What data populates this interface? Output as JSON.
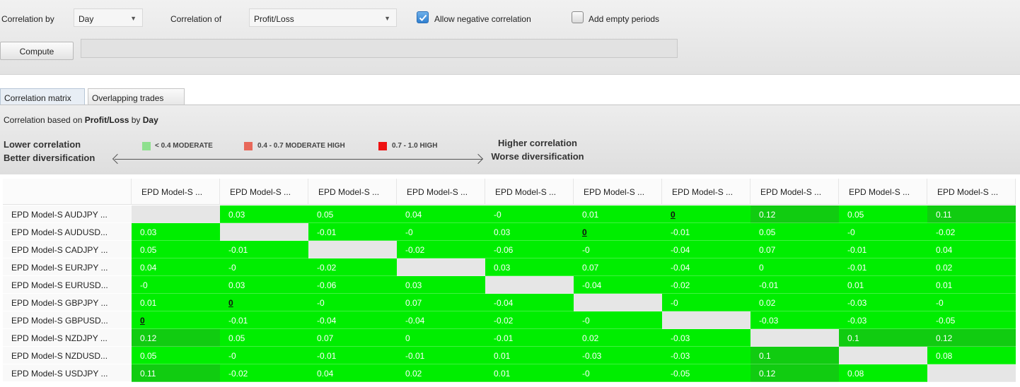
{
  "toolbar": {
    "correlation_by_label": "Correlation by",
    "correlation_by_value": "Day",
    "correlation_of_label": "Correlation of",
    "correlation_of_value": "Profit/Loss",
    "allow_negative_label": "Allow negative correlation",
    "allow_negative_checked": true,
    "add_empty_label": "Add empty periods",
    "add_empty_checked": false,
    "compute_label": "Compute"
  },
  "tabs": [
    {
      "label": "Correlation matrix",
      "active": true
    },
    {
      "label": "Overlapping trades",
      "active": false
    }
  ],
  "info": {
    "prefix": "Correlation based on ",
    "metric": "Profit/Loss",
    "middle": " by ",
    "period": "Day"
  },
  "legend": {
    "lower_line1": "Lower correlation",
    "lower_line2": "Better diversification",
    "higher_line1": "Higher correlation",
    "higher_line2": "Worse diversification",
    "items": [
      {
        "label": "< 0.4 MODERATE",
        "color": "#8ee08e"
      },
      {
        "label": "0.4 - 0.7 MODERATE HIGH",
        "color": "#e8685a"
      },
      {
        "label": "0.7 - 1.0 HIGH",
        "color": "#ee1111"
      }
    ]
  },
  "colors": {
    "low_green": "#00ee00",
    "mid_green": "#11cc11",
    "diagonal": "#e6e6e6"
  },
  "matrix": {
    "col_headers": [
      "EPD Model-S ...",
      "EPD Model-S ...",
      "EPD Model-S ...",
      "EPD Model-S ...",
      "EPD Model-S ...",
      "EPD Model-S ...",
      "EPD Model-S ...",
      "EPD Model-S ...",
      "EPD Model-S ...",
      "EPD Model-S ..."
    ],
    "row_labels": [
      "EPD Model-S AUDJPY ...",
      "EPD Model-S AUDUSD...",
      "EPD Model-S CADJPY ...",
      "EPD Model-S EURJPY ...",
      "EPD Model-S EURUSD...",
      "EPD Model-S GBPJPY ...",
      "EPD Model-S GBPUSD...",
      "EPD Model-S NZDJPY ...",
      "EPD Model-S NZDUSD...",
      "EPD Model-S USDJPY ..."
    ],
    "values": [
      [
        "",
        "0.03",
        "0.05",
        "0.04",
        "-0",
        "0.01",
        "0",
        "0.12",
        "0.05",
        "0.11"
      ],
      [
        "0.03",
        "",
        "-0.01",
        "-0",
        "0.03",
        "0",
        "-0.01",
        "0.05",
        "-0",
        "-0.02"
      ],
      [
        "0.05",
        "-0.01",
        "",
        "-0.02",
        "-0.06",
        "-0",
        "-0.04",
        "0.07",
        "-0.01",
        "0.04"
      ],
      [
        "0.04",
        "-0",
        "-0.02",
        "",
        "0.03",
        "0.07",
        "-0.04",
        "0",
        "-0.01",
        "0.02"
      ],
      [
        "-0",
        "0.03",
        "-0.06",
        "0.03",
        "",
        "-0.04",
        "-0.02",
        "-0.01",
        "0.01",
        "0.01"
      ],
      [
        "0.01",
        "0",
        "-0",
        "0.07",
        "-0.04",
        "",
        "-0",
        "0.02",
        "-0.03",
        "-0"
      ],
      [
        "0",
        "-0.01",
        "-0.04",
        "-0.04",
        "-0.02",
        "-0",
        "",
        "-0.03",
        "-0.03",
        "-0.05"
      ],
      [
        "0.12",
        "0.05",
        "0.07",
        "0",
        "-0.01",
        "0.02",
        "-0.03",
        "",
        "0.1",
        "0.12"
      ],
      [
        "0.05",
        "-0",
        "-0.01",
        "-0.01",
        "0.01",
        "-0.03",
        "-0.03",
        "0.1",
        "",
        "0.08"
      ],
      [
        "0.11",
        "-0.02",
        "0.04",
        "0.02",
        "0.01",
        "-0",
        "-0.05",
        "0.12",
        "0.08",
        ""
      ]
    ],
    "bold_zero_cells": [
      [
        0,
        6
      ],
      [
        1,
        5
      ],
      [
        5,
        1
      ],
      [
        6,
        0
      ]
    ]
  }
}
